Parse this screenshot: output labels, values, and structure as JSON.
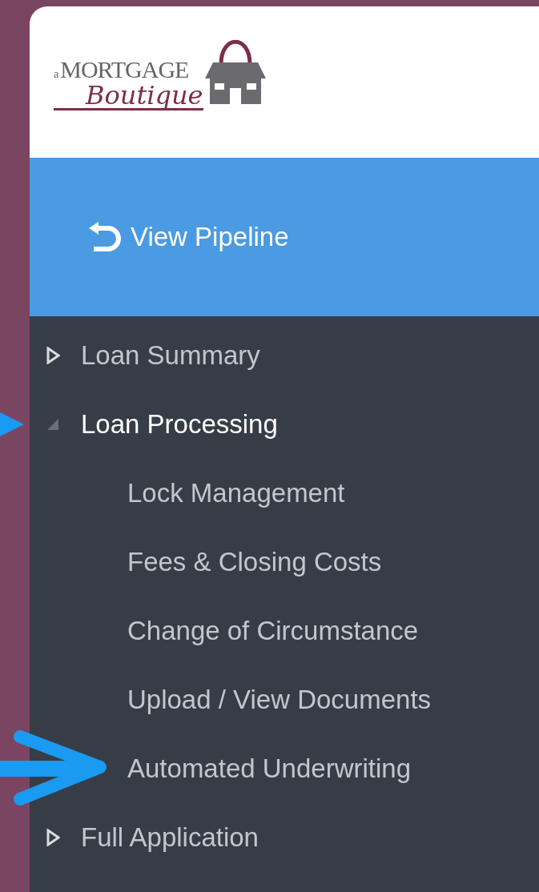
{
  "logo": {
    "prefix": "a",
    "word": "MORTGAGE",
    "script": "Boutique"
  },
  "header": {
    "link": "View Pipeline"
  },
  "nav": [
    {
      "label": "Loan Summary",
      "expanded": false,
      "selected": false
    },
    {
      "label": "Loan Processing",
      "expanded": true,
      "selected": true,
      "children": [
        {
          "label": "Lock Management"
        },
        {
          "label": "Fees & Closing Costs"
        },
        {
          "label": "Change of Circumstance"
        },
        {
          "label": "Upload / View Documents"
        },
        {
          "label": "Automated Underwriting"
        }
      ]
    },
    {
      "label": "Full Application",
      "expanded": false,
      "selected": false
    }
  ]
}
